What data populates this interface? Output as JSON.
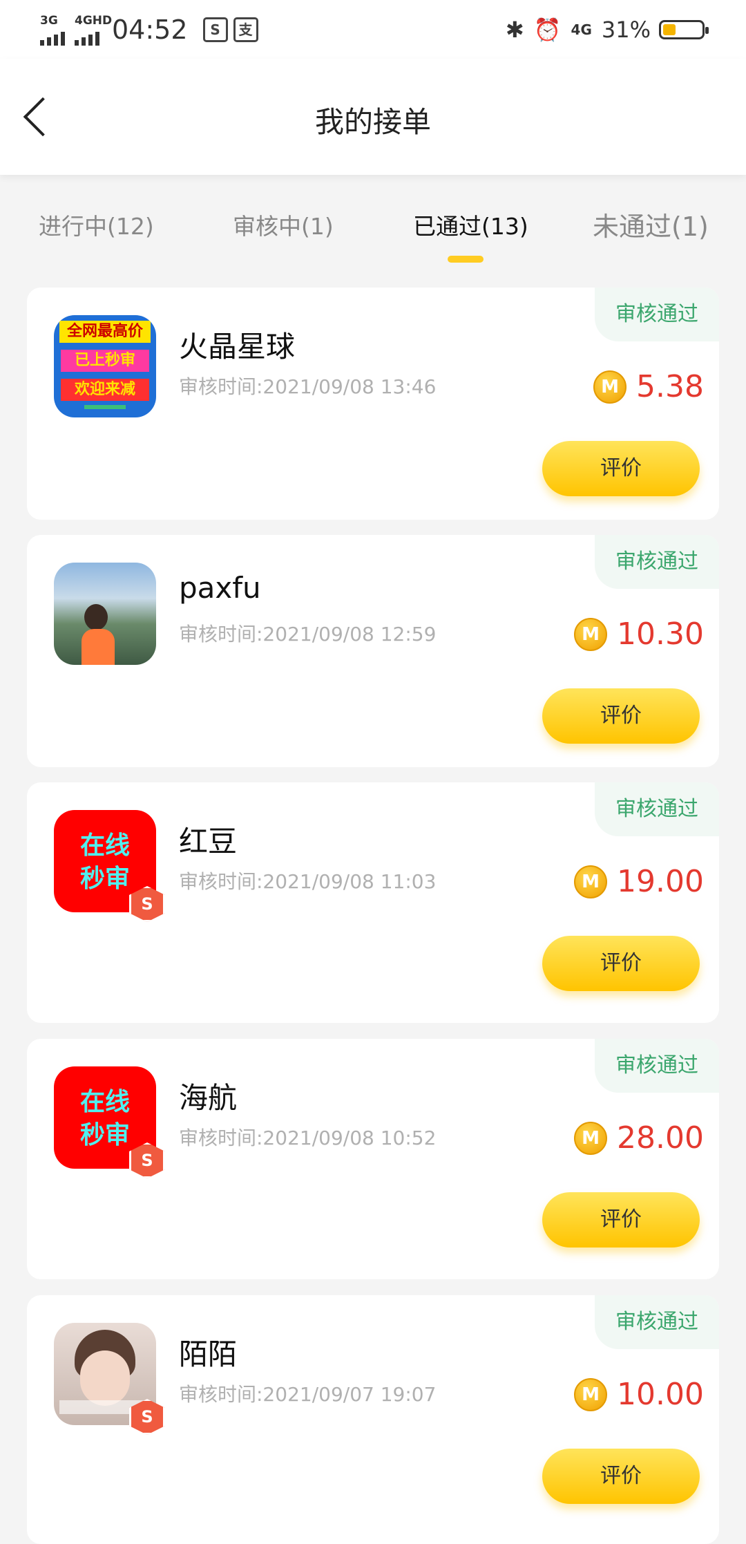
{
  "statusbar": {
    "net1": "3G",
    "net2": "4GHD",
    "time": "04:52",
    "battery": "31%",
    "icons": [
      "signal-icon",
      "shield-s-icon",
      "pay-icon",
      "bluetooth-icon",
      "alarm-icon",
      "4g-icon",
      "battery-icon"
    ]
  },
  "header": {
    "title": "我的接单"
  },
  "tabs": [
    {
      "label": "进行中(12)"
    },
    {
      "label": "审核中(1)"
    },
    {
      "label": "已通过(13)"
    },
    {
      "label": "未通过(1)"
    }
  ],
  "orders": [
    {
      "name": "火晶星球",
      "time": "审核时间:2021/09/08 13:46",
      "status": "审核通过",
      "amount": "5.38",
      "button": "评价",
      "thumb_lines": [
        "全网最高价",
        "已上秒审",
        "欢迎来减"
      ]
    },
    {
      "name": "paxfu",
      "time": "审核时间:2021/09/08 12:59",
      "status": "审核通过",
      "amount": "10.30",
      "button": "评价"
    },
    {
      "name": "红豆",
      "time": "审核时间:2021/09/08 11:03",
      "status": "审核通过",
      "amount": "19.00",
      "button": "评价",
      "thumb_lines": [
        "在线",
        "秒审"
      ]
    },
    {
      "name": "海航",
      "time": "审核时间:2021/09/08 10:52",
      "status": "审核通过",
      "amount": "28.00",
      "button": "评价",
      "thumb_lines": [
        "在线",
        "秒审"
      ]
    },
    {
      "name": "陌陌",
      "time": "审核时间:2021/09/07 19:07",
      "status": "审核通过",
      "amount": "10.00",
      "button": "评价"
    }
  ],
  "coin_letter": "M",
  "badge_letter": "S",
  "colors": {
    "accent": "#ffc400",
    "amount": "#e4392f",
    "status": "#3ba66d"
  }
}
